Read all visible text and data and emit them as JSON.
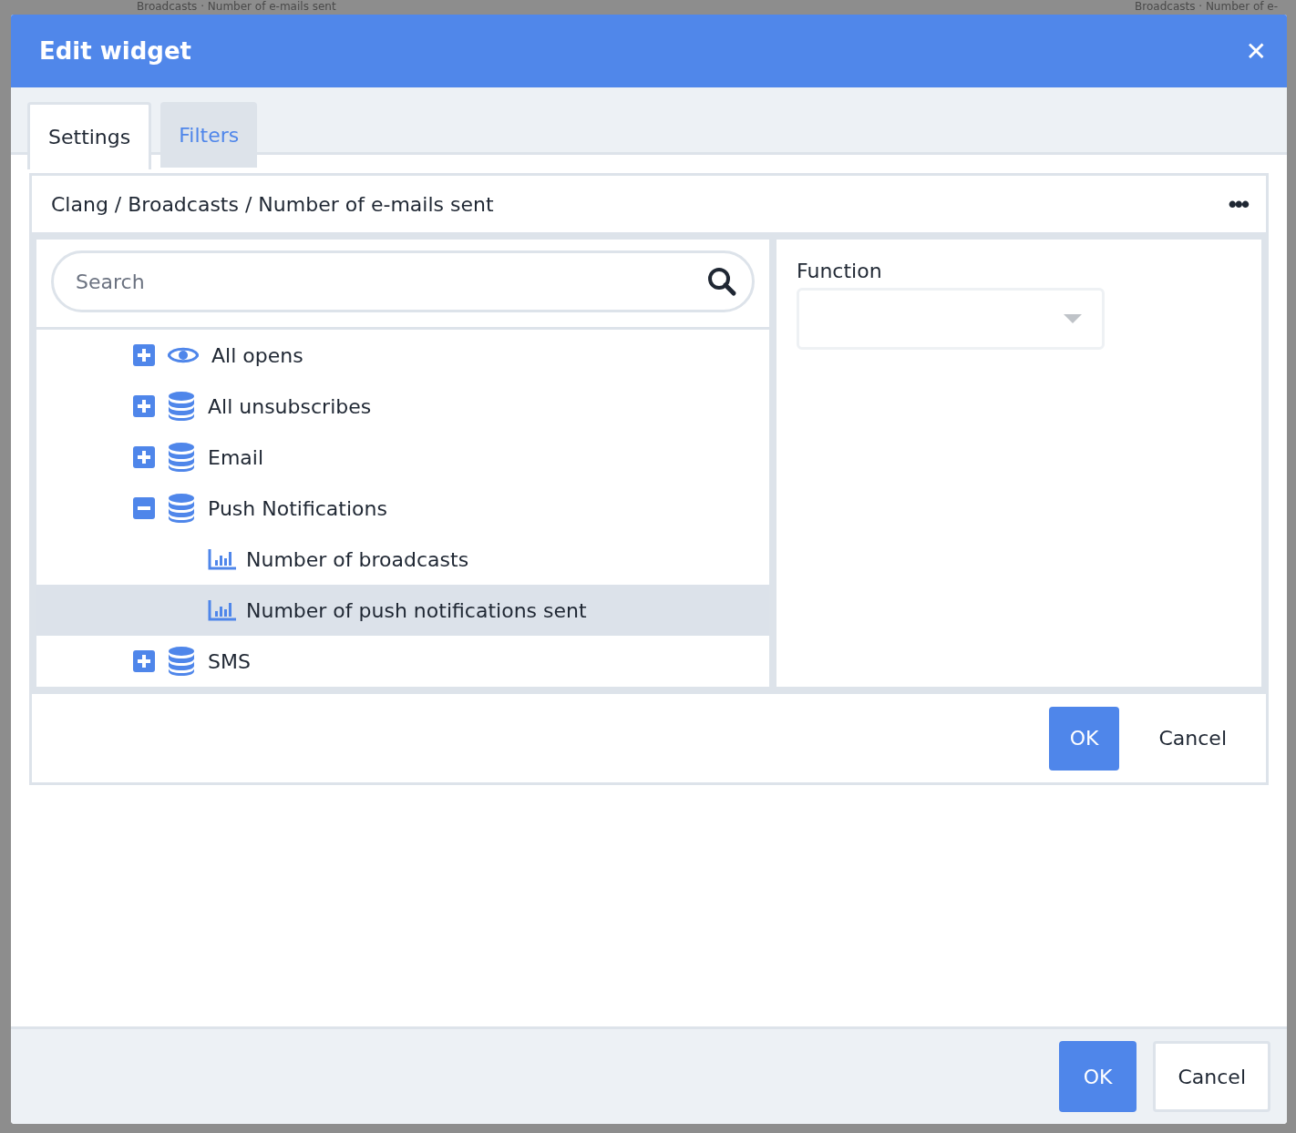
{
  "backdrop": {
    "titles": [
      "Broadcasts · Number of e-mails sent",
      "Broadcasts · Number of e-"
    ]
  },
  "dialog": {
    "title": "Edit widget",
    "close_label": "✕"
  },
  "tabs": [
    {
      "label": "Settings",
      "selected": true
    },
    {
      "label": "Filters",
      "selected": false
    }
  ],
  "path": {
    "text": "Clang / Broadcasts / Number of e-mails sent",
    "menu_label": "•••"
  },
  "search": {
    "placeholder": "Search"
  },
  "tree": [
    {
      "label": "All opens",
      "kind": "eye",
      "expanded": false,
      "selected": false
    },
    {
      "label": "All unsubscribes",
      "kind": "database",
      "expanded": false,
      "selected": false
    },
    {
      "label": "Email",
      "kind": "database",
      "expanded": false,
      "selected": false
    },
    {
      "label": "Push Notifications",
      "kind": "database",
      "expanded": true,
      "selected": false,
      "children": [
        {
          "label": "Number of broadcasts",
          "kind": "chart",
          "selected": false
        },
        {
          "label": "Number of push notifications sent",
          "kind": "chart",
          "selected": true
        }
      ]
    },
    {
      "label": "SMS",
      "kind": "database",
      "expanded": false,
      "selected": false
    }
  ],
  "function": {
    "label": "Function"
  },
  "inner_buttons": [
    {
      "label": "OK",
      "kind": "primary"
    },
    {
      "label": "Cancel",
      "kind": "plain"
    }
  ],
  "footer_buttons": [
    {
      "label": "OK",
      "kind": "primary"
    },
    {
      "label": "Cancel",
      "kind": "outline"
    }
  ]
}
